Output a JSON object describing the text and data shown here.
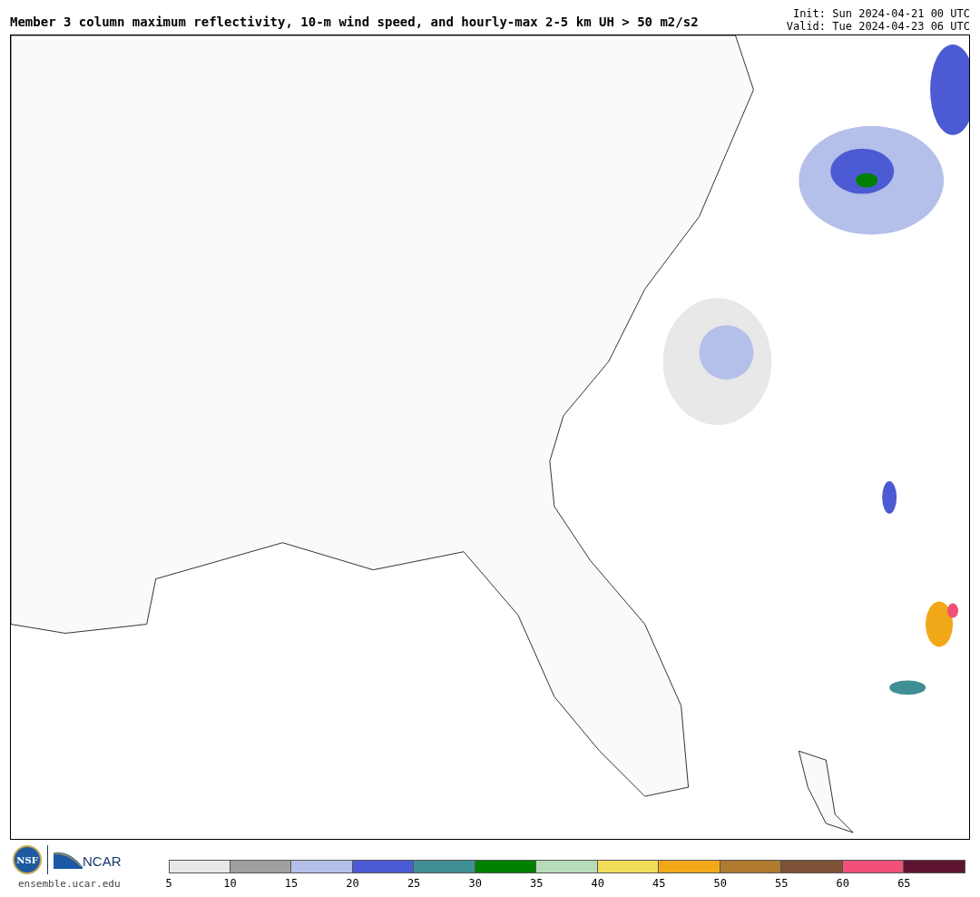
{
  "title": "Member 3 column maximum reflectivity, 10-m wind speed, and hourly-max 2-5 km UH > 50 m2/s2",
  "init": "Init: Sun 2024-04-21 00 UTC",
  "valid": "Valid: Tue 2024-04-23 06 UTC",
  "logos": {
    "nsf": "NSF",
    "ncar": "NCAR",
    "url": "ensemble.ucar.edu"
  },
  "colorbar": [
    {
      "label": "5",
      "color": "#e8e8e8"
    },
    {
      "label": "10",
      "color": "#a0a0a0"
    },
    {
      "label": "15",
      "color": "#b4bfea"
    },
    {
      "label": "20",
      "color": "#4c5bd4"
    },
    {
      "label": "25",
      "color": "#3f8f95"
    },
    {
      "label": "30",
      "color": "#008000"
    },
    {
      "label": "35",
      "color": "#b8dcb8"
    },
    {
      "label": "40",
      "color": "#f0dc5a"
    },
    {
      "label": "45",
      "color": "#f0a818"
    },
    {
      "label": "50",
      "color": "#b07a2f"
    },
    {
      "label": "55",
      "color": "#7e5237"
    },
    {
      "label": "60",
      "color": "#f05078"
    },
    {
      "label": "65",
      "color": "#5e1430"
    }
  ]
}
